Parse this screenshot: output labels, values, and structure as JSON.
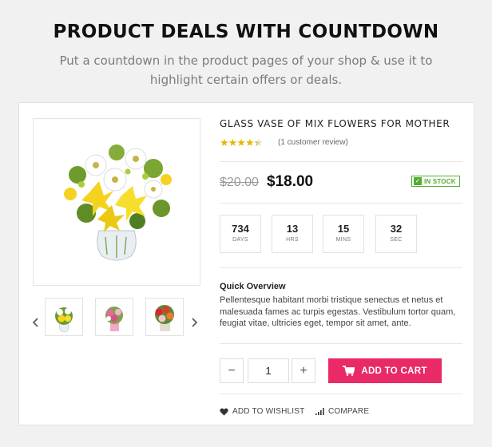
{
  "header": {
    "title": "PRODUCT DEALS WITH COUNTDOWN",
    "subtitle": "Put a countdown in the product pages of your shop & use it to highlight certain offers or deals."
  },
  "gallery": {
    "main_image": "yellow-lily-bouquet-in-glass-vase",
    "thumbnails": [
      "yellow-bouquet",
      "pink-bouquet",
      "red-rose-bouquet"
    ],
    "prev_icon": "chevron-left-icon",
    "next_icon": "chevron-right-icon"
  },
  "product": {
    "title": "GLASS VASE OF MIX FLOWERS FOR MOTHER",
    "rating_value": 4.5,
    "rating_max": 5,
    "stars_text": "★★★★★",
    "review_text": "(1 customer review)",
    "old_price": "$20.00",
    "new_price": "$18.00",
    "stock_label": "IN STOCK",
    "stock_icon": "✓"
  },
  "countdown": [
    {
      "value": "734",
      "label": "DAYS"
    },
    {
      "value": "13",
      "label": "HRS"
    },
    {
      "value": "15",
      "label": "MINS"
    },
    {
      "value": "32",
      "label": "SEC"
    }
  ],
  "overview": {
    "title": "Quick Overview",
    "text": "Pellentesque habitant morbi tristique senectus et netus et malesuada fames ac turpis egestas. Vestibulum tortor quam, feugiat vitae, ultricies eget, tempor sit amet, ante."
  },
  "cart": {
    "quantity": "1",
    "minus_label": "−",
    "plus_label": "+",
    "add_label": "ADD TO CART"
  },
  "actions": {
    "wishlist_label": "ADD TO WISHLIST",
    "compare_label": "COMPARE"
  },
  "colors": {
    "accent": "#ea2a67",
    "in_stock": "#55ad2f",
    "stars": "#e5b800"
  }
}
